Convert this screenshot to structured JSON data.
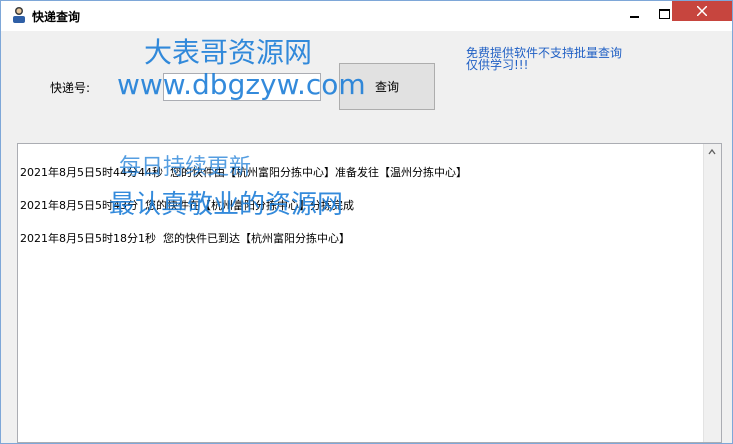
{
  "window": {
    "title": "快递查询",
    "controls": {
      "minimize": "minimize",
      "maximize": "maximize",
      "close": "close"
    }
  },
  "form": {
    "tracking_label": "快递号:",
    "tracking_value": "",
    "query_button": "查询"
  },
  "notice": {
    "line1": "免费提供软件不支持批量查询",
    "line2": "仅供学习!!!"
  },
  "results": {
    "lines": [
      "2021年8月5日5时44分44秒  您的快件由【杭州富阳分拣中心】准备发往【温州分拣中心】",
      "2021年8月5日5时43分  您的快件在【杭州富阳分拣中心】分拣完成",
      "2021年8月5日5时18分1秒  您的快件已到达【杭州富阳分拣中心】"
    ]
  },
  "watermark": {
    "line1": "大表哥资源网",
    "line2": "www.dbgzyw.com",
    "line3": "每日持续更新",
    "line4": "最认真敬业的资源网",
    "color": "#1d7ed8"
  },
  "icons": {
    "app": "person-icon",
    "scroll_up": "chevron-up-icon"
  }
}
